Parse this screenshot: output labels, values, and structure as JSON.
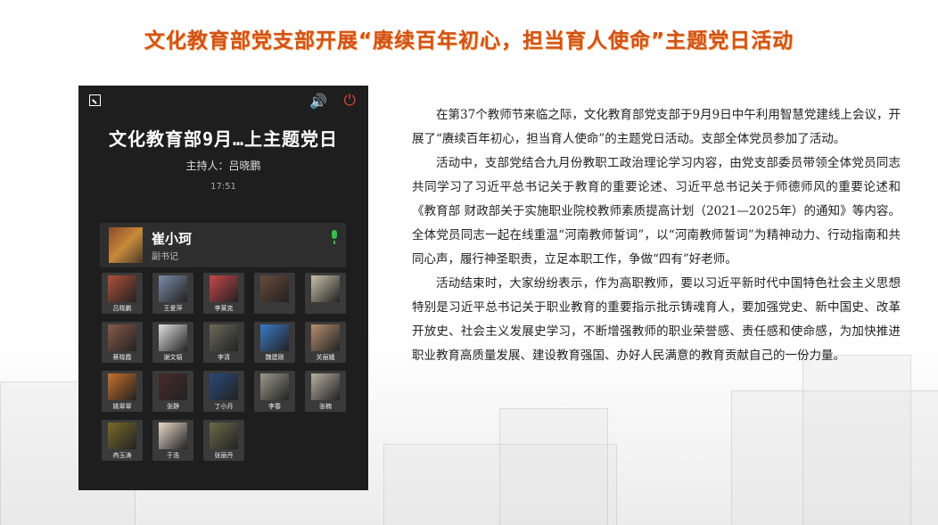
{
  "page": {
    "title": "文化教育部党支部开展“赓续百年初心，担当育人使命”主题党日活动"
  },
  "meeting": {
    "title": "文化教育部9月…上主题党日",
    "host": "主持人：吕晓鹏",
    "time": "17:51",
    "speaker": {
      "name": "崔小珂",
      "role": "副书记"
    },
    "participants": [
      {
        "name": "吕晓鹏",
        "color": "#b0503a"
      },
      {
        "name": "王爱萍",
        "color": "#7a8ca8"
      },
      {
        "name": "李莱克",
        "color": "#c8464a"
      },
      {
        "name": "",
        "color": "#6a4a3a"
      },
      {
        "name": "",
        "color": "#c8c0a8"
      },
      {
        "name": "蔡晓霞",
        "color": "#8a5a4a"
      },
      {
        "name": "谢文韬",
        "color": "#e0e0e0"
      },
      {
        "name": "李清",
        "color": "#6a6a5a"
      },
      {
        "name": "魏建刚",
        "color": "#3a7ac8"
      },
      {
        "name": "关丽娥",
        "color": "#b89070"
      },
      {
        "name": "姚翠翠",
        "color": "#c8702a"
      },
      {
        "name": "张静",
        "color": "#4a2a2a"
      },
      {
        "name": "丁小月",
        "color": "#2a4a7a"
      },
      {
        "name": "李春",
        "color": "#9a9a8a"
      },
      {
        "name": "张楠",
        "color": "#b8b0a0"
      },
      {
        "name": "冉玉涛",
        "color": "#7a6a2a"
      },
      {
        "name": "于浩",
        "color": "#e8d8c8"
      },
      {
        "name": "张丽丹",
        "color": "#6a6a4a"
      }
    ]
  },
  "article": {
    "paragraphs": [
      "在第37个教师节来临之际，文化教育部党支部于9月9日中午利用智慧党建线上会议，开展了“赓续百年初心，担当育人使命”的主题党日活动。支部全体党员参加了活动。",
      "活动中，支部党结合九月份教职工政治理论学习内容，由党支部委员带领全体党员同志共同学习了习近平总书记关于教育的重要论述、习近平总书记关于师德师风的重要论述和《教育部 财政部关于实施职业院校教师素质提高计划（2021—2025年）的通知》等内容。全体党员同志一起在线重温“河南教师誓词”，以“河南教师誓词”为精神动力、行动指南和共同心声，履行神圣职责，立足本职工作，争做“四有”好老师。",
      "活动结束时，大家纷纷表示，作为高职教师，要以习近平新时代中国特色社会主义思想特别是习近平总书记关于职业教育的重要指示批示铸魂育人，要加强党史、新中国史、改革开放史、社会主义发展史学习，不断增强教师的职业荣誉感、责任感和使命感，为加快推进职业教育高质量发展、建设教育强国、办好人民满意的教育贡献自己的一份力量。"
    ]
  }
}
